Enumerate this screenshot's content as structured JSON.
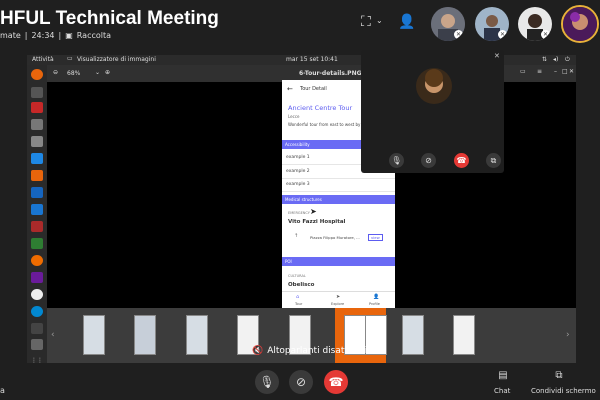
{
  "header": {
    "title": "HFUL Technical Meeting",
    "subtitle_left": "mate",
    "duration": "24:34",
    "collection_label": "Raccolta"
  },
  "shared_screen": {
    "topbar": {
      "activities": "Attività",
      "app_name": "Visualizzatore di immagini",
      "datetime": "mar 15 set  10:41"
    },
    "titlebar": {
      "zoom": "68%",
      "filename": "6-Tour-details.PNG"
    },
    "phone": {
      "header_title": "Tour Detail",
      "tour_title": "Ancient Centre Tour",
      "city": "Lecce",
      "description": "Wonderful tour from east to west by Kanye",
      "accessibility_header": "Accessibility",
      "accessibility_items": [
        "example 1",
        "example 2",
        "example 3"
      ],
      "structures_header": "Medical structures",
      "structure_label": "EMERGENCY",
      "structure_name": "Vito Fazzi Hospital",
      "structure_address": "Piazza Filippo Muratore, ...",
      "view_label": "view",
      "poi_header": "POI",
      "poi_label": "CULTURAL",
      "poi_name": "Obelisco",
      "bottom_nav": [
        "Tour",
        "Explore",
        "Profile"
      ]
    }
  },
  "notice": "Altoparlanti disattivati",
  "footer": {
    "left_text": "a",
    "chat_label": "Chat",
    "share_label": "Condividi schermo"
  },
  "colors": {
    "accent": "#6a6bf4",
    "hangup": "#e53935",
    "highlight_thumb": "#e8650c"
  }
}
